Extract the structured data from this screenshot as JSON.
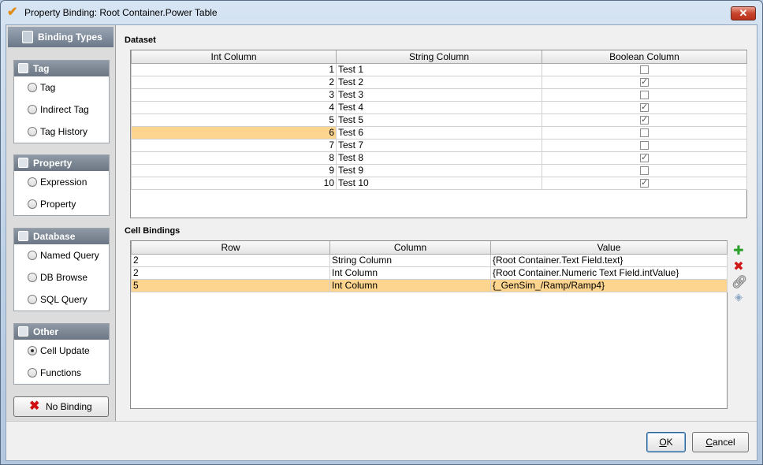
{
  "window": {
    "title": "Property Binding: Root Container.Power Table",
    "close_label": "✕"
  },
  "sidebar": {
    "header": "Binding Types",
    "groups": [
      {
        "label": "Tag",
        "icon": "tag-icon",
        "options": [
          {
            "label": "Tag",
            "selected": false
          },
          {
            "label": "Indirect Tag",
            "selected": false
          },
          {
            "label": "Tag History",
            "selected": false
          }
        ]
      },
      {
        "label": "Property",
        "icon": "link-icon",
        "options": [
          {
            "label": "Expression",
            "selected": false
          },
          {
            "label": "Property",
            "selected": false
          }
        ]
      },
      {
        "label": "Database",
        "icon": "database-icon",
        "options": [
          {
            "label": "Named Query",
            "selected": false
          },
          {
            "label": "DB Browse",
            "selected": false
          },
          {
            "label": "SQL Query",
            "selected": false
          }
        ]
      },
      {
        "label": "Other",
        "icon": "search-icon",
        "options": [
          {
            "label": "Cell Update",
            "selected": true
          },
          {
            "label": "Functions",
            "selected": false
          }
        ]
      }
    ],
    "no_binding_label": "No Binding"
  },
  "dataset": {
    "label": "Dataset",
    "columns": [
      "Int Column",
      "String Column",
      "Boolean Column"
    ],
    "rows": [
      {
        "int": "1",
        "str": "Test 1",
        "bool": false
      },
      {
        "int": "2",
        "str": "Test 2",
        "bool": true
      },
      {
        "int": "3",
        "str": "Test 3",
        "bool": false
      },
      {
        "int": "4",
        "str": "Test 4",
        "bool": true
      },
      {
        "int": "5",
        "str": "Test 5",
        "bool": true
      },
      {
        "int": "6",
        "str": "Test 6",
        "bool": false
      },
      {
        "int": "7",
        "str": "Test 7",
        "bool": false
      },
      {
        "int": "8",
        "str": "Test 8",
        "bool": true
      },
      {
        "int": "9",
        "str": "Test 9",
        "bool": false
      },
      {
        "int": "10",
        "str": "Test 10",
        "bool": true
      }
    ],
    "selected_row": 5
  },
  "cell_bindings": {
    "label": "Cell Bindings",
    "columns": [
      "Row",
      "Column",
      "Value"
    ],
    "rows": [
      {
        "row": "2",
        "column": "String Column",
        "value": "{Root Container.Text Field.text}"
      },
      {
        "row": "2",
        "column": "Int Column",
        "value": "{Root Container.Numeric Text Field.intValue}"
      },
      {
        "row": "5",
        "column": "Int Column",
        "value": "{_GenSim_/Ramp/Ramp4}"
      }
    ],
    "selected_row": 2
  },
  "footer": {
    "ok_label": "OK",
    "cancel_label": "Cancel"
  },
  "colors": {
    "selection": "#fdd58f",
    "header_gray": "#6c7684"
  }
}
